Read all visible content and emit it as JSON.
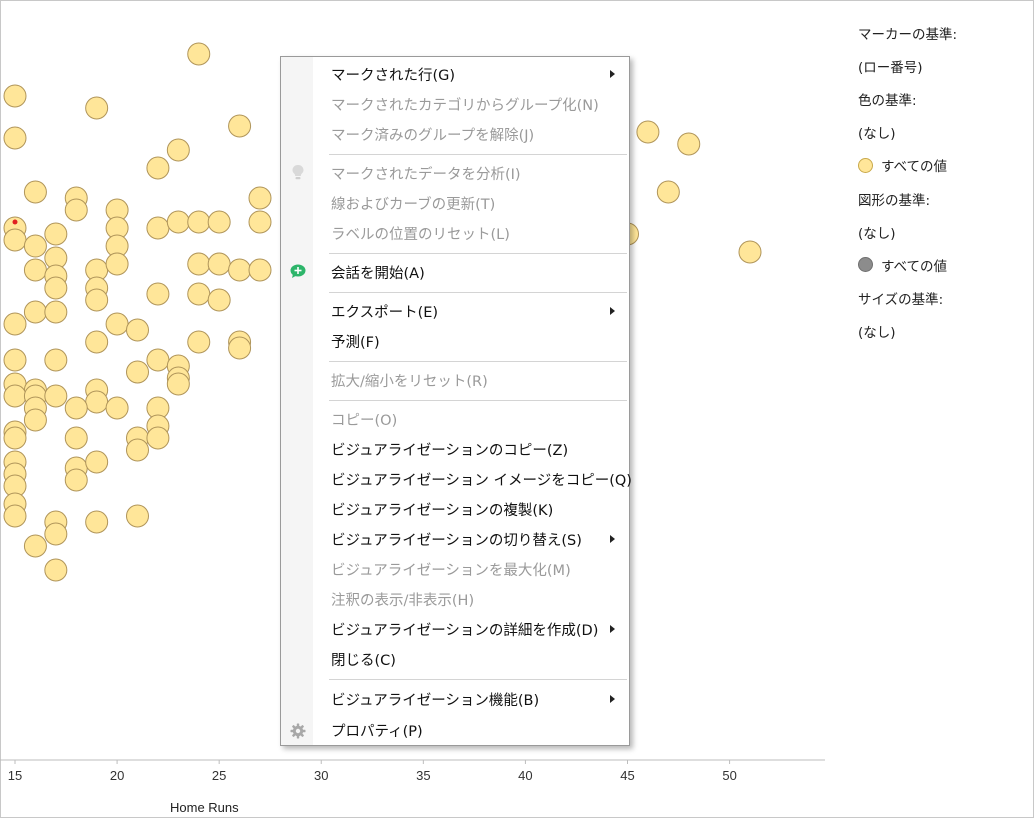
{
  "chart_data": {
    "type": "scatter",
    "xlabel": "Home Runs",
    "x_ticks": [
      15,
      20,
      25,
      30,
      35,
      40,
      45,
      50
    ],
    "x_range": [
      13,
      55
    ],
    "y_range": [
      0,
      100
    ],
    "marker_color": "#ffe699",
    "marker_stroke": "#b0955a",
    "points": [
      {
        "x": 24,
        "y": 96
      },
      {
        "x": 15,
        "y": 89
      },
      {
        "x": 19,
        "y": 87
      },
      {
        "x": 26,
        "y": 84
      },
      {
        "x": 15,
        "y": 82
      },
      {
        "x": 23,
        "y": 80
      },
      {
        "x": 22,
        "y": 77
      },
      {
        "x": 16,
        "y": 73
      },
      {
        "x": 18,
        "y": 72
      },
      {
        "x": 18,
        "y": 70
      },
      {
        "x": 20,
        "y": 70
      },
      {
        "x": 27,
        "y": 72
      },
      {
        "x": 15,
        "y": 67
      },
      {
        "x": 17,
        "y": 66
      },
      {
        "x": 20,
        "y": 67
      },
      {
        "x": 22,
        "y": 67
      },
      {
        "x": 23,
        "y": 68
      },
      {
        "x": 24,
        "y": 68
      },
      {
        "x": 25,
        "y": 68
      },
      {
        "x": 27,
        "y": 68
      },
      {
        "x": 15,
        "y": 65
      },
      {
        "x": 16,
        "y": 64
      },
      {
        "x": 20,
        "y": 64
      },
      {
        "x": 17,
        "y": 62
      },
      {
        "x": 24,
        "y": 61
      },
      {
        "x": 25,
        "y": 61
      },
      {
        "x": 26,
        "y": 60
      },
      {
        "x": 16,
        "y": 60
      },
      {
        "x": 17,
        "y": 59
      },
      {
        "x": 19,
        "y": 60
      },
      {
        "x": 20,
        "y": 61
      },
      {
        "x": 27,
        "y": 60
      },
      {
        "x": 17,
        "y": 57
      },
      {
        "x": 19,
        "y": 57
      },
      {
        "x": 22,
        "y": 56
      },
      {
        "x": 24,
        "y": 56
      },
      {
        "x": 19,
        "y": 55
      },
      {
        "x": 25,
        "y": 55
      },
      {
        "x": 16,
        "y": 53
      },
      {
        "x": 17,
        "y": 53
      },
      {
        "x": 15,
        "y": 51
      },
      {
        "x": 20,
        "y": 51
      },
      {
        "x": 21,
        "y": 50
      },
      {
        "x": 19,
        "y": 48
      },
      {
        "x": 24,
        "y": 48
      },
      {
        "x": 26,
        "y": 48
      },
      {
        "x": 26,
        "y": 47
      },
      {
        "x": 15,
        "y": 45
      },
      {
        "x": 17,
        "y": 45
      },
      {
        "x": 22,
        "y": 45
      },
      {
        "x": 23,
        "y": 44
      },
      {
        "x": 21,
        "y": 43
      },
      {
        "x": 23,
        "y": 42
      },
      {
        "x": 15,
        "y": 41
      },
      {
        "x": 16,
        "y": 40
      },
      {
        "x": 19,
        "y": 40
      },
      {
        "x": 23,
        "y": 41
      },
      {
        "x": 15,
        "y": 39
      },
      {
        "x": 16,
        "y": 39
      },
      {
        "x": 17,
        "y": 39
      },
      {
        "x": 19,
        "y": 38
      },
      {
        "x": 16,
        "y": 37
      },
      {
        "x": 18,
        "y": 37
      },
      {
        "x": 20,
        "y": 37
      },
      {
        "x": 22,
        "y": 37
      },
      {
        "x": 16,
        "y": 35
      },
      {
        "x": 22,
        "y": 34
      },
      {
        "x": 15,
        "y": 33
      },
      {
        "x": 15,
        "y": 32
      },
      {
        "x": 18,
        "y": 32
      },
      {
        "x": 21,
        "y": 32
      },
      {
        "x": 22,
        "y": 32
      },
      {
        "x": 21,
        "y": 30
      },
      {
        "x": 15,
        "y": 28
      },
      {
        "x": 18,
        "y": 27
      },
      {
        "x": 19,
        "y": 28
      },
      {
        "x": 15,
        "y": 26
      },
      {
        "x": 18,
        "y": 25
      },
      {
        "x": 15,
        "y": 24
      },
      {
        "x": 15,
        "y": 21
      },
      {
        "x": 15,
        "y": 19
      },
      {
        "x": 17,
        "y": 18
      },
      {
        "x": 19,
        "y": 18
      },
      {
        "x": 21,
        "y": 19
      },
      {
        "x": 17,
        "y": 16
      },
      {
        "x": 16,
        "y": 14
      },
      {
        "x": 17,
        "y": 10
      },
      {
        "x": 46,
        "y": 83
      },
      {
        "x": 48,
        "y": 81
      },
      {
        "x": 47,
        "y": 73
      },
      {
        "x": 45,
        "y": 66
      },
      {
        "x": 51,
        "y": 63
      }
    ],
    "marked_point": {
      "x": 15,
      "y": 68
    }
  },
  "legend": {
    "marker_by_label": "マーカーの基準:",
    "marker_by_value": "(ロー番号)",
    "color_by_label": "色の基準:",
    "color_by_value": "(なし)",
    "color_item": "すべての値",
    "shape_by_label": "図形の基準:",
    "shape_by_value": "(なし)",
    "shape_item": "すべての値",
    "size_by_label": "サイズの基準:",
    "size_by_value": "(なし)"
  },
  "context_menu": {
    "items": [
      {
        "label": "マークされた行(G)",
        "enabled": true,
        "submenu": true
      },
      {
        "label": "マークされたカテゴリからグループ化(N)",
        "enabled": false
      },
      {
        "label": "マーク済みのグループを解除(J)",
        "enabled": false
      },
      {
        "label": "マークされたデータを分析(I)",
        "enabled": false,
        "icon": "lightbulb-icon"
      },
      {
        "label": "線およびカーブの更新(T)",
        "enabled": false
      },
      {
        "label": "ラベルの位置のリセット(L)",
        "enabled": false
      },
      {
        "label": "会話を開始(A)",
        "enabled": true,
        "icon": "add-comment-icon"
      },
      {
        "label": "エクスポート(E)",
        "enabled": true,
        "submenu": true
      },
      {
        "label": "予測(F)",
        "enabled": true
      },
      {
        "label": "拡大/縮小をリセット(R)",
        "enabled": false
      },
      {
        "label": "コピー(O)",
        "enabled": false
      },
      {
        "label": "ビジュアライゼーションのコピー(Z)",
        "enabled": true
      },
      {
        "label": "ビジュアライゼーション イメージをコピー(Q)",
        "enabled": true
      },
      {
        "label": "ビジュアライゼーションの複製(K)",
        "enabled": true
      },
      {
        "label": "ビジュアライゼーションの切り替え(S)",
        "enabled": true,
        "submenu": true
      },
      {
        "label": "ビジュアライゼーションを最大化(M)",
        "enabled": false
      },
      {
        "label": "注釈の表示/非表示(H)",
        "enabled": false
      },
      {
        "label": "ビジュアライゼーションの詳細を作成(D)",
        "enabled": true,
        "submenu": true
      },
      {
        "label": "閉じる(C)",
        "enabled": true
      },
      {
        "label": "ビジュアライゼーション機能(B)",
        "enabled": true,
        "submenu": true
      },
      {
        "label": "プロパティ(P)",
        "enabled": true,
        "icon": "gear-icon"
      }
    ]
  }
}
